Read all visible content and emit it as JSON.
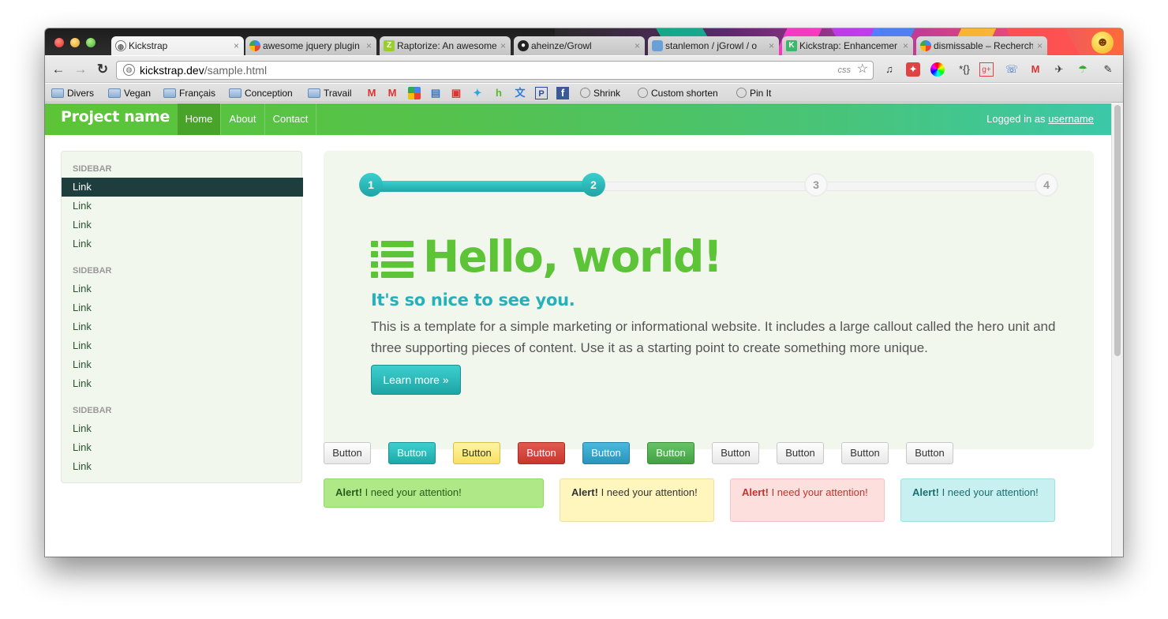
{
  "browser": {
    "tabs": [
      {
        "title": "Kickstrap",
        "icon": "globe-icon"
      },
      {
        "title": "awesome jquery plugin",
        "icon": "google-icon"
      },
      {
        "title": "Raptorize: An awesome",
        "icon": "raptor-icon"
      },
      {
        "title": "aheinze/Growl",
        "icon": "github-icon"
      },
      {
        "title": "stanlemon / jGrowl / o",
        "icon": "jgrowl-icon"
      },
      {
        "title": "Kickstrap: Enhancemer",
        "icon": "kickstrap-icon"
      },
      {
        "title": "dismissable – Recherch",
        "icon": "google-icon"
      }
    ],
    "close_glyph": "×",
    "url_host": "kickstrap.dev",
    "url_path": "/sample.html",
    "url_tag": "css",
    "bookmarks": {
      "divers": "Divers",
      "vegan": "Vegan",
      "francais": "Français",
      "conception": "Conception",
      "travail": "Travail",
      "shrink": "Shrink",
      "custom_shorten": "Custom shorten",
      "pin_it": "Pin It"
    }
  },
  "navbar": {
    "brand": "Project name",
    "items": [
      "Home",
      "About",
      "Contact"
    ],
    "active": "Home",
    "logged_prefix": "Logged in as",
    "username": "username"
  },
  "sidebar": {
    "groups": [
      {
        "header": "SIDEBAR",
        "links": [
          "Link",
          "Link",
          "Link",
          "Link"
        ]
      },
      {
        "header": "SIDEBAR",
        "links": [
          "Link",
          "Link",
          "Link",
          "Link",
          "Link",
          "Link"
        ]
      },
      {
        "header": "SIDEBAR",
        "links": [
          "Link",
          "Link",
          "Link"
        ]
      }
    ]
  },
  "steps": {
    "labels": [
      "1",
      "2",
      "3",
      "4"
    ],
    "completed": 2
  },
  "hero": {
    "title": "Hello, world!",
    "subtitle": "It's so nice to see you.",
    "text": "This is a template for a simple marketing or informational website. It includes a large callout called the hero unit and three supporting pieces of content. Use it as a starting point to create something more unique.",
    "cta": "Learn more »"
  },
  "buttons": [
    "Button",
    "Button",
    "Button",
    "Button",
    "Button",
    "Button",
    "Button",
    "Button",
    "Button",
    "Button"
  ],
  "alerts": {
    "strong": "Alert!",
    "message": "I need your attention!"
  },
  "colors": {
    "brand_green": "#5cc436",
    "accent_teal": "#20a7a7",
    "sidebar_active": "#1e3e3e",
    "hero_bg": "#f2f7ee"
  }
}
